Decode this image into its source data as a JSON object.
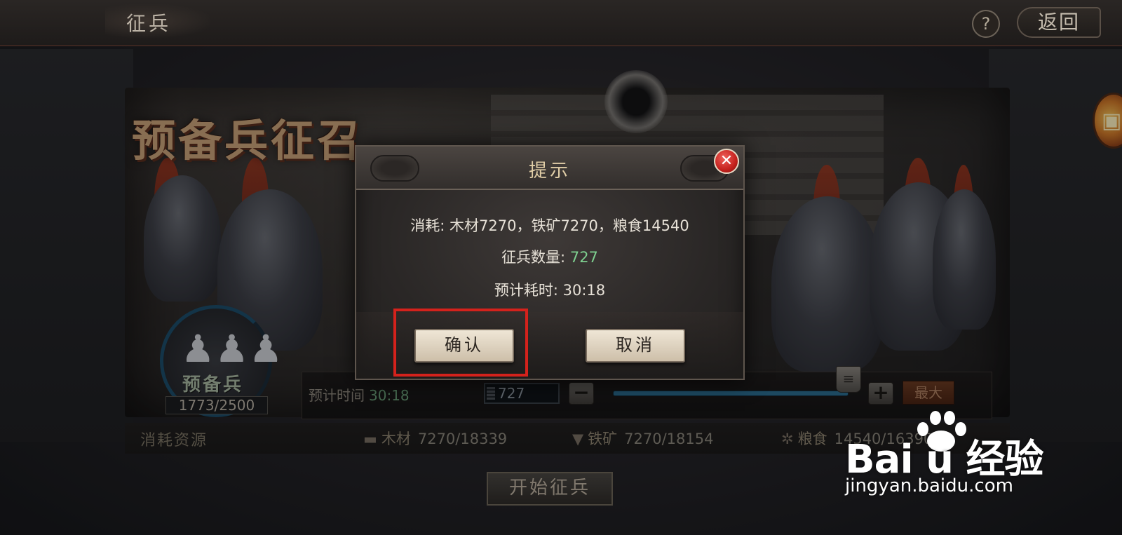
{
  "header": {
    "title": "征兵",
    "help_label": "?",
    "back_label": "返回"
  },
  "banner": {
    "title": "预备兵征召"
  },
  "reserve": {
    "label": "预备兵",
    "count": "1773/2500"
  },
  "recruit": {
    "est_time_label": "预计时间",
    "est_time_value": "30:18",
    "quantity": "727",
    "minus_label": "−",
    "plus_label": "+",
    "max_label": "最大",
    "slider_fraction": 1.0
  },
  "resources": {
    "title": "消耗资源",
    "items": [
      {
        "name": "木材",
        "value": "7270/18339",
        "icon": "wood-icon"
      },
      {
        "name": "铁矿",
        "value": "7270/18154",
        "icon": "iron-icon"
      },
      {
        "name": "粮食",
        "value": "14540/16390",
        "icon": "grain-icon"
      }
    ]
  },
  "start_button": "开始征兵",
  "dialog": {
    "title": "提示",
    "close_label": "✕",
    "cost_line": "消耗: 木材7270，铁矿7270，粮食14540",
    "qty_label": "征兵数量: ",
    "qty_value": "727",
    "time_line": "预计耗时: 30:18",
    "confirm_label": "确认",
    "cancel_label": "取消"
  },
  "watermark": {
    "logo": "Bai  u 经验",
    "url": "jingyan.baidu.com"
  },
  "colors": {
    "accent_green": "#7ecf8f",
    "highlight_red": "#d4221c",
    "slider_blue": "#2b6c90"
  }
}
